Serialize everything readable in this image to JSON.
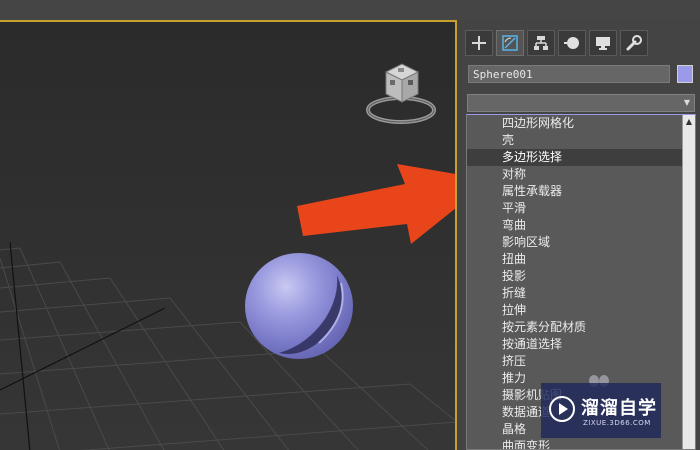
{
  "panel": {
    "object_name": "Sphere001",
    "object_color": "#9a9ae8",
    "tabs": [
      {
        "icon": "create-plus-icon",
        "active": false
      },
      {
        "icon": "modify-icon",
        "active": true
      },
      {
        "icon": "hierarchy-icon",
        "active": false
      },
      {
        "icon": "motion-icon",
        "active": false
      },
      {
        "icon": "display-icon",
        "active": false
      },
      {
        "icon": "utilities-wrench-icon",
        "active": false
      }
    ],
    "modifier_dropdown_value": "",
    "modifier_list": [
      "四边形网格化",
      "壳",
      "多边形选择",
      "对称",
      "属性承载器",
      "平滑",
      "弯曲",
      "影响区域",
      "扭曲",
      "投影",
      "折缝",
      "拉伸",
      "按元素分配材质",
      "按通道选择",
      "挤压",
      "推力",
      "摄影机贴图",
      "数据通道",
      "晶格",
      "曲面变形"
    ],
    "selected_index": 2
  },
  "viewport": {
    "active_border_color": "#c8a030",
    "annotation_arrow_color": "#e8461a",
    "sphere_color": "#8a8ad8"
  },
  "watermark": {
    "title": "溜溜自学",
    "subtitle": "ZIXUE.3D66.COM"
  }
}
